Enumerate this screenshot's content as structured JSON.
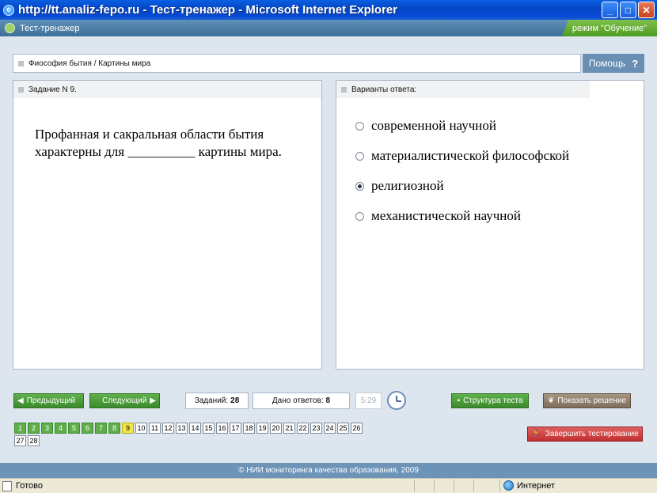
{
  "window": {
    "title": "http://tt.analiz-fepo.ru - Тест-тренажер - Microsoft Internet Explorer",
    "minimize_icon": "minimize-icon",
    "maximize_icon": "maximize-icon",
    "close_icon": "close-icon"
  },
  "header": {
    "app_title": "Тест-тренажер",
    "mode": "режим \"Обучение\""
  },
  "breadcrumb": "Фиософия бытия / Картины мира",
  "help": {
    "label": "Помощь",
    "icon": "?"
  },
  "task": {
    "heading": "Задание N 9.",
    "text": "Профанная и сакральная области бытия характерны для __________ картины мира."
  },
  "answers": {
    "heading": "Варианты ответа:",
    "options": [
      {
        "label": "современной научной",
        "selected": false
      },
      {
        "label": "материалистической философской",
        "selected": false
      },
      {
        "label": "религиозной",
        "selected": true
      },
      {
        "label": "механистической научной",
        "selected": false
      }
    ]
  },
  "nav": {
    "prev": "Предыдущий",
    "next": "Следующий",
    "tasks_label": "Заданий:",
    "tasks_count": "28",
    "answered_label": "Дано ответов:",
    "answered_count": "8",
    "timer": "5:29",
    "structure": "Структура теста",
    "show_solution": "Показать решение",
    "finish": "Завершить тестирование"
  },
  "question_grid": {
    "items": [
      "1",
      "2",
      "3",
      "4",
      "5",
      "6",
      "7",
      "8",
      "9",
      "10",
      "11",
      "12",
      "13",
      "14",
      "15",
      "16",
      "17",
      "18",
      "19",
      "20",
      "21",
      "22",
      "23",
      "24",
      "25",
      "26",
      "27",
      "28"
    ],
    "done_until": 8,
    "current": 9
  },
  "footer": "© НИИ мониторинга качества образования, 2009",
  "status": {
    "left": "Готово",
    "zone": "Интернет"
  },
  "colors": {
    "accent": "#5e90b8",
    "done": "#5fae4a",
    "current": "#f3e64a",
    "finish": "#c23030"
  }
}
